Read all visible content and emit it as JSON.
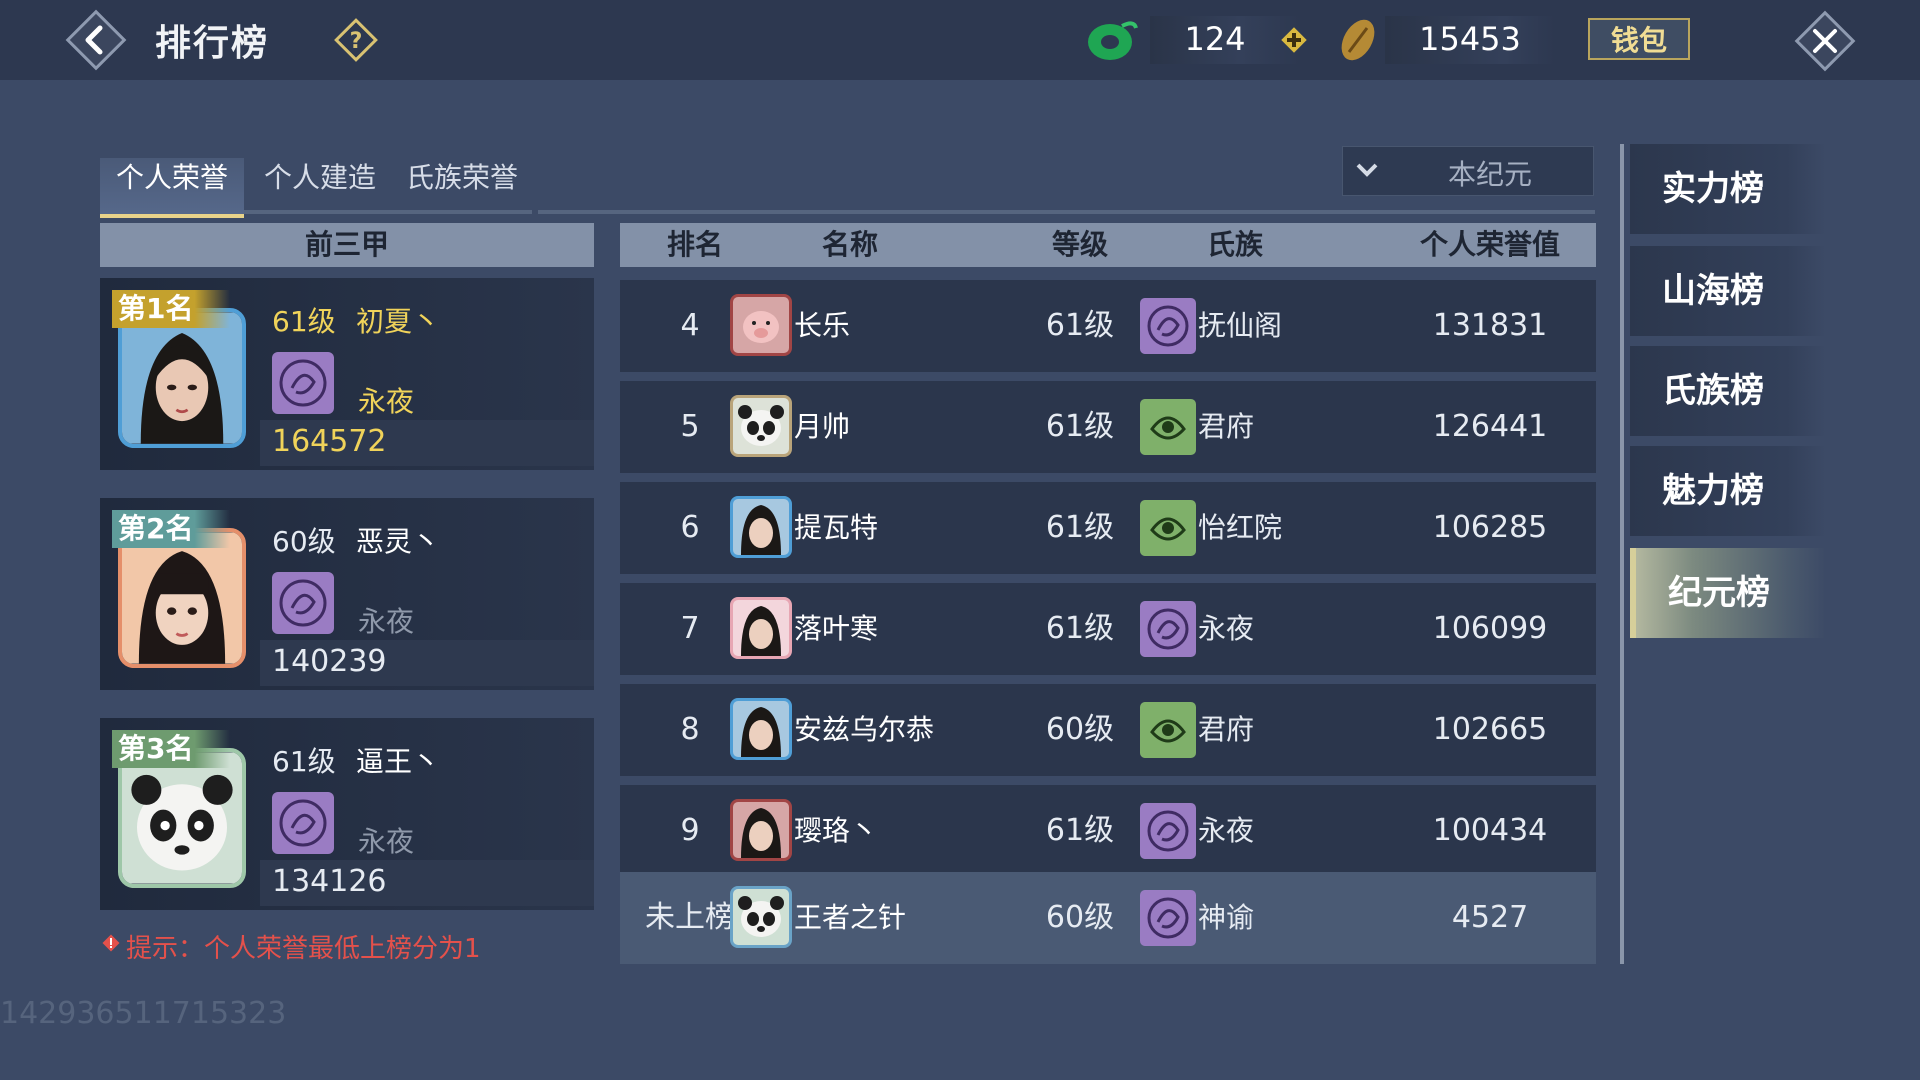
{
  "header": {
    "title": "排行榜",
    "jade_amount": "124",
    "coin_amount": "15453",
    "wallet_label": "钱包"
  },
  "tabs": [
    {
      "label": "个人荣誉",
      "active": true
    },
    {
      "label": "个人建造",
      "active": false
    },
    {
      "label": "氏族荣誉",
      "active": false
    }
  ],
  "era_select": {
    "value": "本纪元"
  },
  "top3": {
    "header": "前三甲",
    "entries": [
      {
        "rank_label": "第1名",
        "level": "61级",
        "name": "初夏丶",
        "clan": "永夜",
        "score": "164572",
        "highlight": "#f0d35a"
      },
      {
        "rank_label": "第2名",
        "level": "60级",
        "name": "恶灵丶",
        "clan": "永夜",
        "score": "140239",
        "highlight": "#e6ebf2"
      },
      {
        "rank_label": "第3名",
        "level": "61级",
        "name": "逼王丶",
        "clan": "永夜",
        "score": "134126",
        "highlight": "#e6ebf2"
      }
    ]
  },
  "table": {
    "columns": [
      "排名",
      "名称",
      "等级",
      "氏族",
      "个人荣誉值"
    ],
    "rows": [
      {
        "rank": "4",
        "name": "长乐",
        "level": "61级",
        "clan": "抚仙阁",
        "score": "131831"
      },
      {
        "rank": "5",
        "name": "月帅",
        "level": "61级",
        "clan": "君府",
        "score": "126441"
      },
      {
        "rank": "6",
        "name": "提瓦特",
        "level": "61级",
        "clan": "怡红院",
        "score": "106285"
      },
      {
        "rank": "7",
        "name": "落叶寒",
        "level": "61级",
        "clan": "永夜",
        "score": "106099"
      },
      {
        "rank": "8",
        "name": "安兹乌尔恭",
        "level": "60级",
        "clan": "君府",
        "score": "102665"
      },
      {
        "rank": "9",
        "name": "璎珞丶",
        "level": "61级",
        "clan": "永夜",
        "score": "100434"
      }
    ],
    "self_row": {
      "rank": "未上榜",
      "name": "王者之针",
      "level": "60级",
      "clan": "神谕",
      "score": "4527"
    }
  },
  "hint": "提示：个人荣誉最低上榜分为1",
  "footer_id": "142936511715323",
  "side_menu": [
    {
      "label": "实力榜",
      "active": false
    },
    {
      "label": "山海榜",
      "active": false
    },
    {
      "label": "氏族榜",
      "active": false
    },
    {
      "label": "魅力榜",
      "active": false
    },
    {
      "label": "纪元榜",
      "active": true
    }
  ]
}
